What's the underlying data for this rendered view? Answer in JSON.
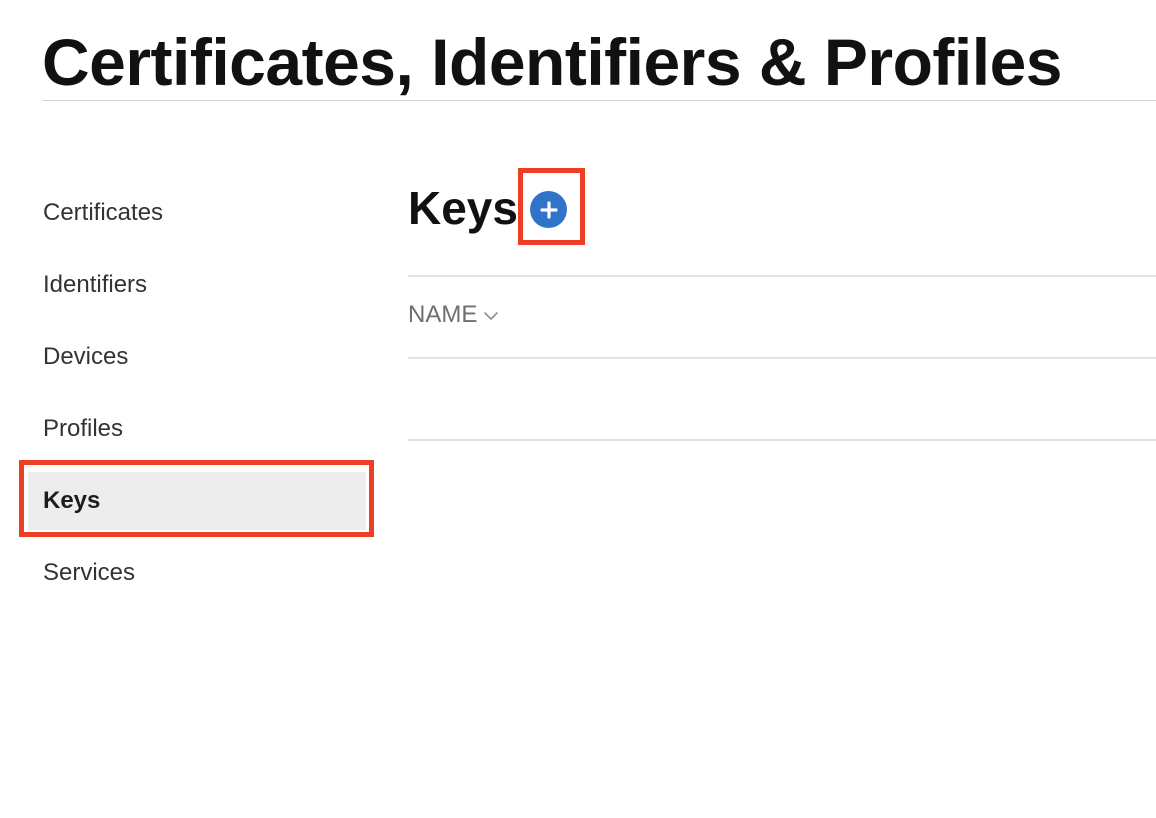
{
  "header": {
    "title": "Certificates, Identifiers & Profiles"
  },
  "sidebar": {
    "items": [
      {
        "label": "Certificates"
      },
      {
        "label": "Identifiers"
      },
      {
        "label": "Devices"
      },
      {
        "label": "Profiles"
      },
      {
        "label": "Keys",
        "selected": true
      },
      {
        "label": "Services"
      }
    ]
  },
  "main": {
    "section_title": "Keys",
    "add_button_icon": "plus-circle-icon",
    "table": {
      "columns": [
        {
          "label": "NAME",
          "sort_icon": "chevron-down-icon"
        }
      ],
      "rows": []
    }
  },
  "colors": {
    "accent": "#2f74c9",
    "highlight": "#ee3f24",
    "selected_background": "#ededed"
  }
}
